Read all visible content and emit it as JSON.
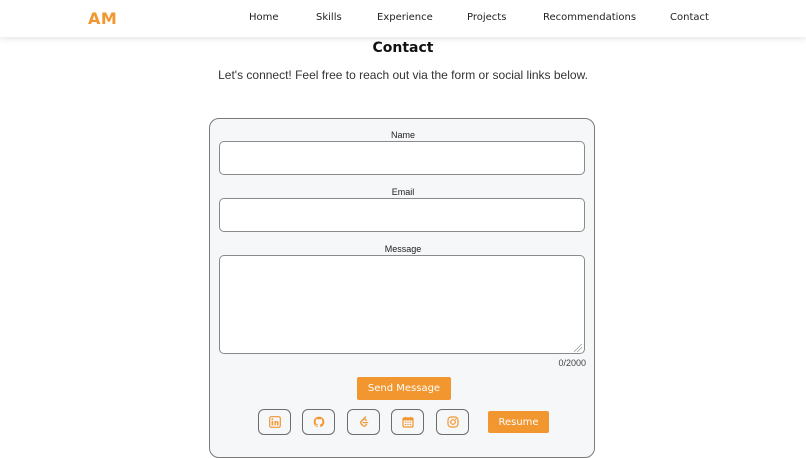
{
  "brand": {
    "logo": "AM",
    "accent": "#f2962f"
  },
  "nav": {
    "items": [
      "Home",
      "Skills",
      "Experience",
      "Projects",
      "Recommendations",
      "Contact"
    ]
  },
  "contact": {
    "title": "Contact",
    "subtitle": "Let's connect! Feel free to reach out via the form or social links below.",
    "form": {
      "name_label": "Name",
      "name_value": "",
      "email_label": "Email",
      "email_value": "",
      "message_label": "Message",
      "message_value": "",
      "counter": "0/2000",
      "send_label": "Send Message"
    },
    "socials": [
      {
        "icon": "linkedin-icon"
      },
      {
        "icon": "github-icon"
      },
      {
        "icon": "leetcode-icon"
      },
      {
        "icon": "calendar-icon"
      },
      {
        "icon": "instagram-icon"
      }
    ],
    "resume_label": "Resume"
  }
}
